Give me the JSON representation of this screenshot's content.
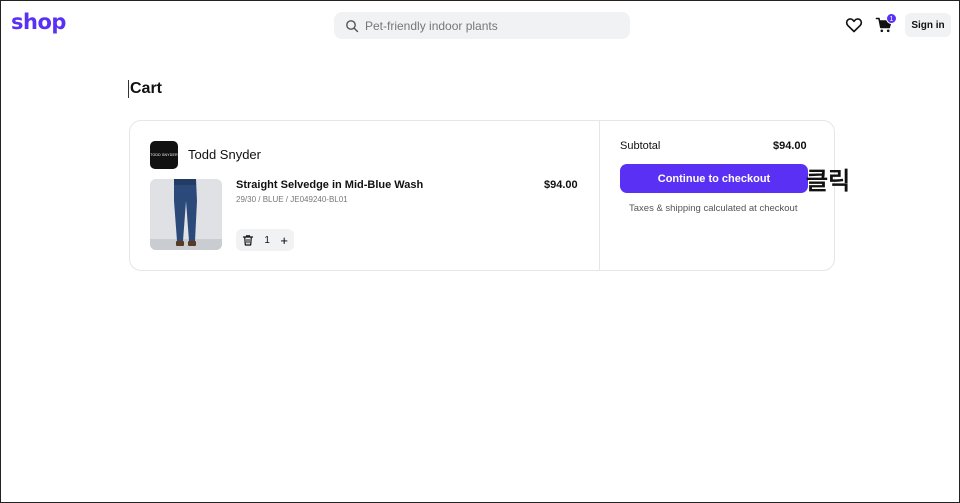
{
  "header": {
    "logo": "shop",
    "search": {
      "placeholder": "Pet-friendly indoor plants"
    },
    "cart_count": "1",
    "signin_label": "Sign in"
  },
  "page": {
    "title": "Cart"
  },
  "cart": {
    "merchant": {
      "name": "Todd Snyder",
      "logo_text": "TODD SNYDER NEW YORK"
    },
    "item": {
      "name": "Straight Selvedge in Mid-Blue Wash",
      "variant": "29/30 / BLUE / JE049240-BL01",
      "price": "$94.00",
      "quantity": "1"
    },
    "summary": {
      "subtotal_label": "Subtotal",
      "subtotal_value": "$94.00",
      "checkout_label": "Continue to checkout",
      "shipping_note": "Taxes & shipping calculated at checkout"
    }
  },
  "annotation": {
    "text": "클릭"
  },
  "colors": {
    "accent": "#5a31f4",
    "surface": "#f1f2f4",
    "border": "#e6e6e6"
  },
  "icons": [
    "search-icon",
    "heart-icon",
    "cart-icon",
    "trash-icon",
    "plus-icon"
  ]
}
